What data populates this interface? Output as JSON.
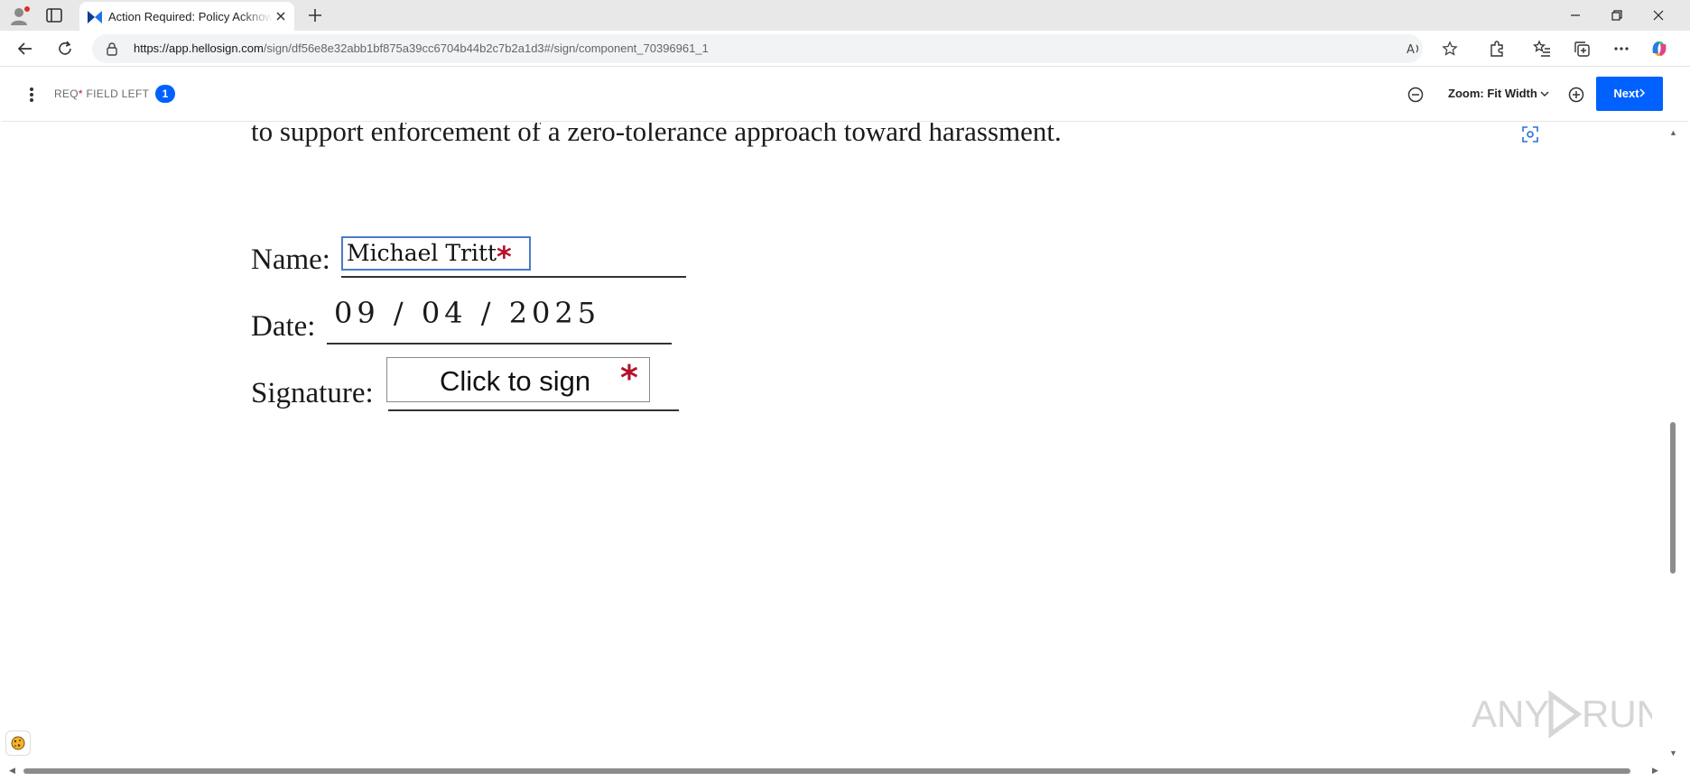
{
  "browser": {
    "tab_title": "Action Required: Policy Acknowledgement",
    "url_host": "https://app.hellosign.com",
    "url_path": "/sign/df56e8e32abb1bf875a39cc6704b44b2c7b2a1d3#/sign/component_70396961_1"
  },
  "app": {
    "req_prefix": "REQ",
    "req_star": "*",
    "req_suffix": " FIELD LEFT",
    "req_count": "1",
    "zoom_label": "Zoom: Fit Width",
    "next_label": "Next"
  },
  "document": {
    "top_text": "to support enforcement of a zero-tolerance approach toward harassment.",
    "name_label": "Name:",
    "name_value": "Michael Tritt",
    "date_label": "Date:",
    "date_value": "09 / 04 / 2025",
    "signature_label": "Signature:",
    "sign_button": "Click to sign",
    "required_mark": "*"
  },
  "watermark": "ANY RUN",
  "colors": {
    "accent": "#0061fe",
    "required": "#b3122d",
    "field_border": "#4a7cc9"
  }
}
